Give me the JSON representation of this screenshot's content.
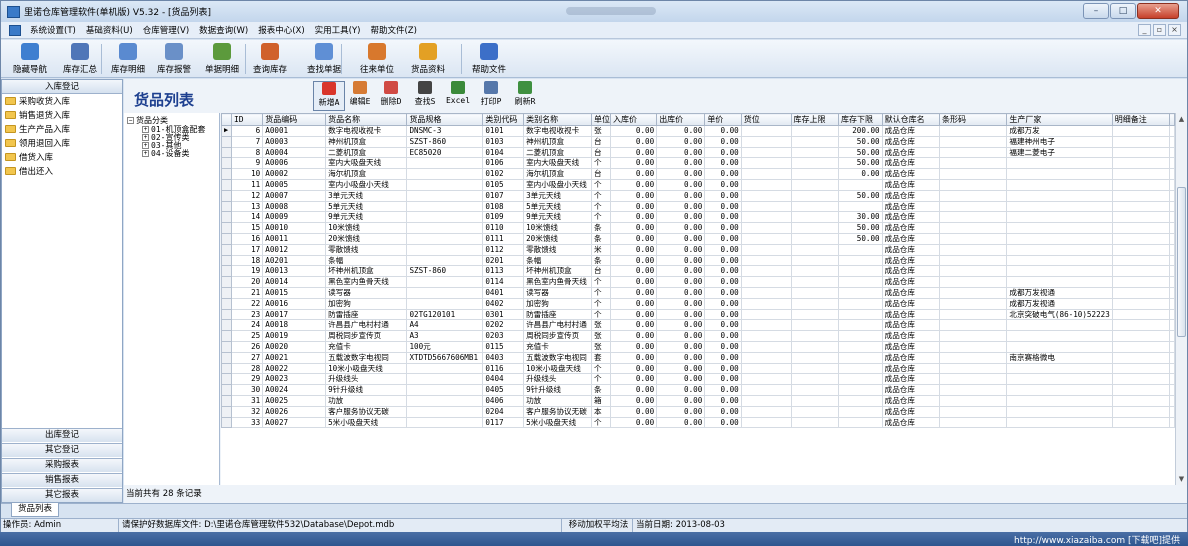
{
  "window": {
    "title": "里诺仓库管理软件(单机版) V5.32 - [货品列表]",
    "minimize": "–",
    "maximize": "□",
    "close": "✕"
  },
  "menu": {
    "items": [
      "系统设置(T)",
      "基础资料(U)",
      "仓库管理(V)",
      "数据查询(W)",
      "报表中心(X)",
      "实用工具(Y)",
      "帮助文件(Z)"
    ],
    "mdi": [
      "_",
      "▫",
      "×"
    ]
  },
  "toolbar": {
    "items": [
      {
        "label": "隐藏导航",
        "icon": "nav-icon",
        "color": "#3f7fd0"
      },
      {
        "label": "库存汇总",
        "icon": "summary-icon",
        "color": "#4f76b8"
      },
      {
        "label": "库存明细",
        "icon": "detail-icon",
        "color": "#5a8ad0"
      },
      {
        "label": "库存报警",
        "icon": "alarm-icon",
        "color": "#6a90c8"
      },
      {
        "label": "单据明细",
        "icon": "docs-icon",
        "color": "#5c9a3c"
      },
      {
        "label": "查询库存",
        "icon": "query-stock-icon",
        "color": "#d0612b"
      },
      {
        "label": "查找单据",
        "icon": "find-doc-icon",
        "color": "#5f8fd5"
      },
      {
        "label": "往来单位",
        "icon": "partners-icon",
        "color": "#d8782d"
      },
      {
        "label": "货品资料",
        "icon": "goods-icon",
        "color": "#e3a024"
      },
      {
        "label": "帮助文件",
        "icon": "help-icon",
        "color": "#3c6fc8"
      }
    ]
  },
  "left": {
    "header": "入库登记",
    "items": [
      "采购收货入库",
      "销售退货入库",
      "生产产品入库",
      "领用退回入库",
      "借货入库",
      "借出还入"
    ],
    "buttons": [
      "出库登记",
      "其它登记",
      "采购报表",
      "销售报表",
      "其它报表"
    ]
  },
  "content": {
    "title": "货品列表",
    "buttons": [
      {
        "label": "新增A",
        "icon": "add-icon",
        "color": "#d9352b"
      },
      {
        "label": "编辑E",
        "icon": "edit-icon",
        "color": "#d67b35"
      },
      {
        "label": "删除D",
        "icon": "delete-icon",
        "color": "#d04a44"
      },
      {
        "label": "查找S",
        "icon": "search-icon",
        "color": "#444444"
      },
      {
        "label": "Excel",
        "icon": "excel-icon",
        "color": "#3a8a3a"
      },
      {
        "label": "打印P",
        "icon": "print-icon",
        "color": "#5577aa"
      },
      {
        "label": "刷新R",
        "icon": "refresh-icon",
        "color": "#3f9040"
      }
    ],
    "tree": {
      "root": "货品分类",
      "children": [
        "01-机顶盒配套",
        "02-宣传类",
        "03-其他",
        "04-设备类"
      ]
    },
    "columns": [
      "ID",
      "货品编码",
      "货品名称",
      "货品规格",
      "类别代码",
      "类别名称",
      "单位",
      "入库价",
      "出库价",
      "单价",
      "货位",
      "库存上限",
      "库存下限",
      "默认仓库名",
      "条形码",
      "生产厂家",
      "明细备注"
    ],
    "rows": [
      [
        "6",
        "A0001",
        "数字电视收视卡",
        "DNSMC-3",
        "0101",
        "数字电视收视卡",
        "张",
        "0.00",
        "0.00",
        "0.00",
        "",
        "",
        "200.00",
        "成品仓库",
        "",
        "成都万发",
        ""
      ],
      [
        "7",
        "A0003",
        "神州机顶盒",
        "SZST-860",
        "0103",
        "神州机顶盒",
        "台",
        "0.00",
        "0.00",
        "0.00",
        "",
        "",
        "50.00",
        "成品仓库",
        "",
        "福建神州电子",
        ""
      ],
      [
        "8",
        "A0004",
        "二菱机顶盒",
        "EC85020",
        "0104",
        "二菱机顶盒",
        "台",
        "0.00",
        "0.00",
        "0.00",
        "",
        "",
        "50.00",
        "成品仓库",
        "",
        "福建二菱电子",
        ""
      ],
      [
        "9",
        "A0006",
        "室内大吸盘天线",
        "",
        "0106",
        "室内大吸盘天线",
        "个",
        "0.00",
        "0.00",
        "0.00",
        "",
        "",
        "50.00",
        "成品仓库",
        "",
        "",
        ""
      ],
      [
        "10",
        "A0002",
        "海尔机顶盒",
        "",
        "0102",
        "海尔机顶盒",
        "台",
        "0.00",
        "0.00",
        "0.00",
        "",
        "",
        "0.00",
        "成品仓库",
        "",
        "",
        ""
      ],
      [
        "11",
        "A0005",
        "室内小吸盘小天线",
        "",
        "0105",
        "室内小吸盘小天线",
        "个",
        "0.00",
        "0.00",
        "0.00",
        "",
        "",
        "",
        "成品仓库",
        "",
        "",
        ""
      ],
      [
        "12",
        "A0007",
        "3单元天线",
        "",
        "0107",
        "3单元天线",
        "个",
        "0.00",
        "0.00",
        "0.00",
        "",
        "",
        "50.00",
        "成品仓库",
        "",
        "",
        ""
      ],
      [
        "13",
        "A0008",
        "5单元天线",
        "",
        "0108",
        "5单元天线",
        "个",
        "0.00",
        "0.00",
        "0.00",
        "",
        "",
        "",
        "成品仓库",
        "",
        "",
        ""
      ],
      [
        "14",
        "A0009",
        "9单元天线",
        "",
        "0109",
        "9单元天线",
        "个",
        "0.00",
        "0.00",
        "0.00",
        "",
        "",
        "30.00",
        "成品仓库",
        "",
        "",
        ""
      ],
      [
        "15",
        "A0010",
        "10米馈线",
        "",
        "0110",
        "10米馈线",
        "条",
        "0.00",
        "0.00",
        "0.00",
        "",
        "",
        "50.00",
        "成品仓库",
        "",
        "",
        ""
      ],
      [
        "16",
        "A0011",
        "20米馈线",
        "",
        "0111",
        "20米馈线",
        "条",
        "0.00",
        "0.00",
        "0.00",
        "",
        "",
        "50.00",
        "成品仓库",
        "",
        "",
        ""
      ],
      [
        "17",
        "A0012",
        "零散馈线",
        "",
        "0112",
        "零散馈线",
        "米",
        "0.00",
        "0.00",
        "0.00",
        "",
        "",
        "",
        "成品仓库",
        "",
        "",
        ""
      ],
      [
        "18",
        "A0201",
        "条幅",
        "",
        "0201",
        "条幅",
        "条",
        "0.00",
        "0.00",
        "0.00",
        "",
        "",
        "",
        "成品仓库",
        "",
        "",
        ""
      ],
      [
        "19",
        "A0013",
        "坏神州机顶盒",
        "SZST-860",
        "0113",
        "坏神州机顶盒",
        "台",
        "0.00",
        "0.00",
        "0.00",
        "",
        "",
        "",
        "成品仓库",
        "",
        "",
        ""
      ],
      [
        "20",
        "A0014",
        "黑色室内鱼骨天线",
        "",
        "0114",
        "黑色室内鱼骨天线",
        "个",
        "0.00",
        "0.00",
        "0.00",
        "",
        "",
        "",
        "成品仓库",
        "",
        "",
        ""
      ],
      [
        "21",
        "A0015",
        "读写器",
        "",
        "0401",
        "读写器",
        "个",
        "0.00",
        "0.00",
        "0.00",
        "",
        "",
        "",
        "成品仓库",
        "",
        "成都万发视通",
        ""
      ],
      [
        "22",
        "A0016",
        "加密狗",
        "",
        "0402",
        "加密狗",
        "个",
        "0.00",
        "0.00",
        "0.00",
        "",
        "",
        "",
        "成品仓库",
        "",
        "成都万发视通",
        ""
      ],
      [
        "23",
        "A0017",
        "防雷插座",
        "02TG120101",
        "0301",
        "防雷插座",
        "个",
        "0.00",
        "0.00",
        "0.00",
        "",
        "",
        "",
        "成品仓库",
        "",
        "北京突破电气(86-10)52223",
        ""
      ],
      [
        "24",
        "A0018",
        "许昌县广电村村通",
        "A4",
        "0202",
        "许昌县广电村村通",
        "张",
        "0.00",
        "0.00",
        "0.00",
        "",
        "",
        "",
        "成品仓库",
        "",
        "",
        ""
      ],
      [
        "25",
        "A0019",
        "周税同步宣传页",
        "A3",
        "0203",
        "周税同步宣传页",
        "张",
        "0.00",
        "0.00",
        "0.00",
        "",
        "",
        "",
        "成品仓库",
        "",
        "",
        ""
      ],
      [
        "26",
        "A0020",
        "充值卡",
        "100元",
        "0115",
        "充值卡",
        "张",
        "0.00",
        "0.00",
        "0.00",
        "",
        "",
        "",
        "成品仓库",
        "",
        "",
        ""
      ],
      [
        "27",
        "A0021",
        "五载波数字电视同",
        "XTDTD5667606MB1",
        "0403",
        "五载波数字电视同",
        "套",
        "0.00",
        "0.00",
        "0.00",
        "",
        "",
        "",
        "成品仓库",
        "",
        "南京赛格微电",
        ""
      ],
      [
        "28",
        "A0022",
        "10米小吸盘天线",
        "",
        "0116",
        "10米小吸盘天线",
        "个",
        "0.00",
        "0.00",
        "0.00",
        "",
        "",
        "",
        "成品仓库",
        "",
        "",
        ""
      ],
      [
        "29",
        "A0023",
        "升级线头",
        "",
        "0404",
        "升级线头",
        "个",
        "0.00",
        "0.00",
        "0.00",
        "",
        "",
        "",
        "成品仓库",
        "",
        "",
        ""
      ],
      [
        "30",
        "A0024",
        "9针升级线",
        "",
        "0405",
        "9针升级线",
        "条",
        "0.00",
        "0.00",
        "0.00",
        "",
        "",
        "",
        "成品仓库",
        "",
        "",
        ""
      ],
      [
        "31",
        "A0025",
        "功放",
        "",
        "0406",
        "功放",
        "箱",
        "0.00",
        "0.00",
        "0.00",
        "",
        "",
        "",
        "成品仓库",
        "",
        "",
        ""
      ],
      [
        "32",
        "A0026",
        "客户服务协议无碳",
        "",
        "0204",
        "客户服务协议无碳",
        "本",
        "0.00",
        "0.00",
        "0.00",
        "",
        "",
        "",
        "成品仓库",
        "",
        "",
        ""
      ],
      [
        "33",
        "A0027",
        "5米小吸盘天线",
        "",
        "0117",
        "5米小吸盘天线",
        "个",
        "0.00",
        "0.00",
        "0.00",
        "",
        "",
        "",
        "成品仓库",
        "",
        "",
        ""
      ]
    ],
    "count_text": "当前共有 28 条记录"
  },
  "tabs": [
    "货品列表"
  ],
  "status": {
    "operator": "操作员: Admin",
    "backup": "请保护好数据库文件: D:\\里诺仓库管理软件532\\Database\\Depot.mdb",
    "method": "移动加权平均法",
    "date": "当前日期: 2013-08-03"
  },
  "footer": "http://www.xiazaiba.com [下载吧]提供"
}
